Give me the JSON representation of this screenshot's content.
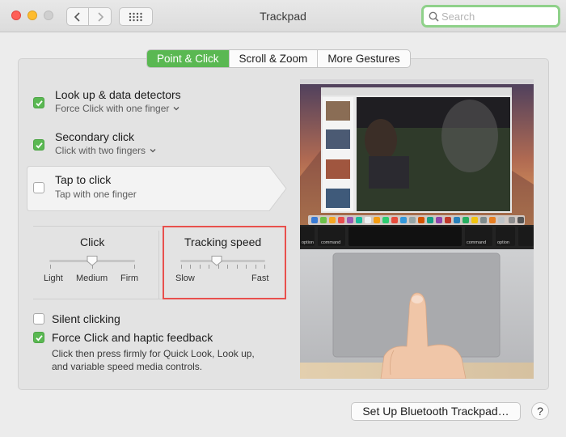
{
  "window": {
    "title": "Trackpad",
    "search_placeholder": "Search"
  },
  "tabs": [
    {
      "label": "Point & Click",
      "active": true
    },
    {
      "label": "Scroll & Zoom",
      "active": false
    },
    {
      "label": "More Gestures",
      "active": false
    }
  ],
  "options": [
    {
      "title": "Look up & data detectors",
      "subtitle": "Force Click with one finger",
      "checked": true,
      "has_dropdown": true
    },
    {
      "title": "Secondary click",
      "subtitle": "Click with two fingers",
      "checked": true,
      "has_dropdown": true
    },
    {
      "title": "Tap to click",
      "subtitle": "Tap with one finger",
      "checked": false,
      "has_dropdown": false
    }
  ],
  "click_slider": {
    "title": "Click",
    "labels": [
      "Light",
      "Medium",
      "Firm"
    ],
    "value_index": 1
  },
  "tracking_slider": {
    "title": "Tracking speed",
    "min_label": "Slow",
    "max_label": "Fast",
    "value_fraction": 0.43
  },
  "silent_clicking": {
    "label": "Silent clicking",
    "checked": false
  },
  "force_click": {
    "label": "Force Click and haptic feedback",
    "checked": true,
    "description_1": "Click then press firmly for Quick Look, Look up,",
    "description_2": "and variable speed media controls."
  },
  "touchbar": {
    "keys": [
      "option",
      "command",
      "command",
      "option"
    ]
  },
  "footer": {
    "setup_button": "Set Up Bluetooth Trackpad…",
    "help_button": "?"
  },
  "colors": {
    "accent_green": "#5ab852",
    "highlight_red": "#e8504d",
    "search_focus": "#8fd18a"
  }
}
